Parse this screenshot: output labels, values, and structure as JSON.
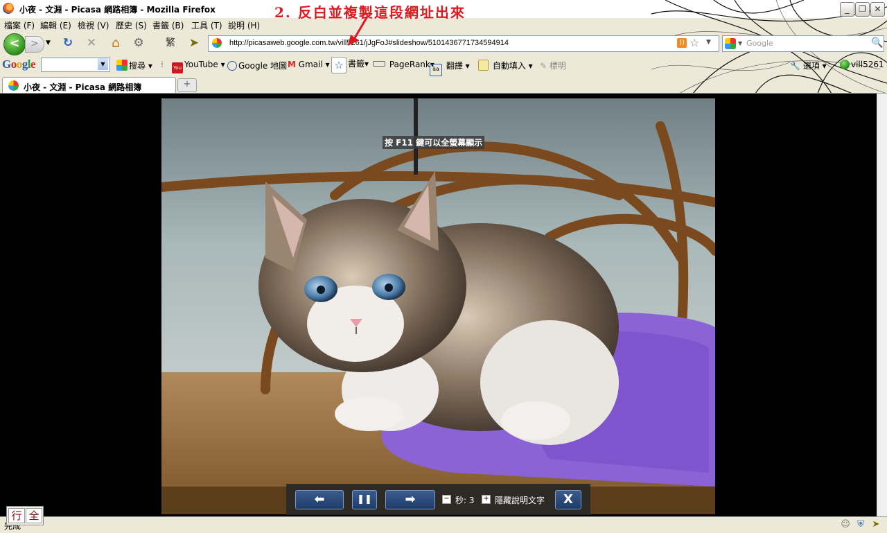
{
  "window": {
    "title": "小夜 - 文淵 - Picasa 網路相簿 - Mozilla Firefox"
  },
  "annotation": "2. 反白並複製這段網址出來",
  "menu": [
    "檔案 (F)",
    "編輯 (E)",
    "檢視 (V)",
    "歷史 (S)",
    "書籤 (B)",
    "工具 (T)",
    "說明 (H)"
  ],
  "nav": {
    "back_glyph": "<",
    "fwd_glyph": ">",
    "reload_glyph": "↻",
    "stop_glyph": "✕",
    "home_glyph": "⌂",
    "trad_char": "繁"
  },
  "url": "http://picasaweb.google.com.tw/vill5261/jJgFoJ#slideshow/5101436771734594914",
  "search": {
    "placeholder": "Google"
  },
  "google_toolbar": {
    "logo": "Google",
    "search_btn": "搜尋",
    "items": [
      "YouTube",
      "Google 地圖",
      "Gmail",
      "書籤",
      "PageRank",
      "翻譯",
      "自動填入",
      "標明"
    ],
    "options": "選項",
    "user": "vill5261"
  },
  "tab": {
    "label": "小夜 - 文淵 - Picasa 網路相簿",
    "new_tab": "+"
  },
  "slideshow": {
    "fullscreen_tip": "按 F11 鍵可以全螢幕顯示",
    "prev": "⬅",
    "pause": "❚❚",
    "next": "➡",
    "minus": "−",
    "seconds_label": "秒: 3",
    "plus": "+",
    "hide_caption": "隱藏說明文字",
    "close": "X"
  },
  "status": {
    "text": "完成"
  },
  "ime": [
    "行",
    "全"
  ],
  "colors": {
    "annotation": "#e0171d",
    "url_selection": "#316ac5",
    "content_bg": "#000000"
  }
}
